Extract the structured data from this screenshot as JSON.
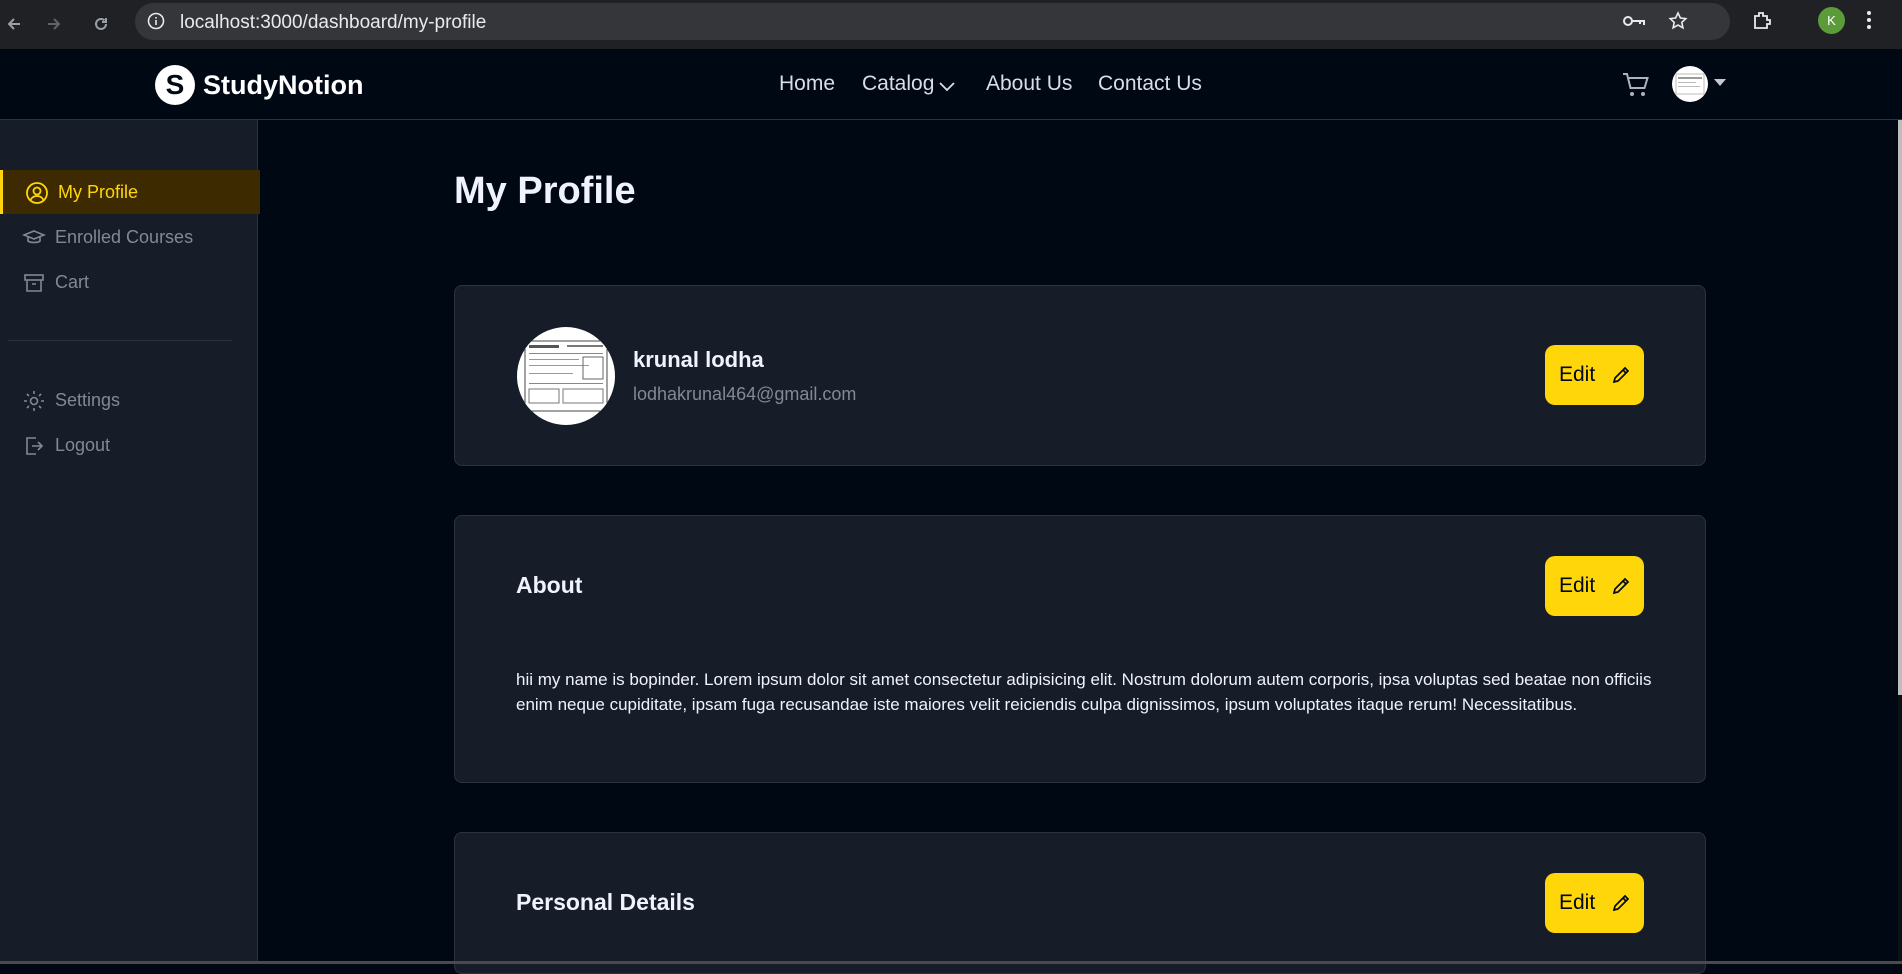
{
  "browser": {
    "url": "localhost:3000/dashboard/my-profile",
    "profile_initial": "K"
  },
  "navbar": {
    "brand": "StudyNotion",
    "brand_mark": "S",
    "links": [
      "Home",
      "Catalog",
      "About Us",
      "Contact Us"
    ]
  },
  "sidebar": {
    "items": [
      {
        "label": "My Profile",
        "icon": "user-circle-icon",
        "active": true
      },
      {
        "label": "Enrolled Courses",
        "icon": "graduation-cap-icon",
        "active": false
      },
      {
        "label": "Cart",
        "icon": "archive-icon",
        "active": false
      }
    ],
    "settings_label": "Settings",
    "logout_label": "Logout"
  },
  "main": {
    "title": "My Profile",
    "profile": {
      "name": "krunal lodha",
      "email": "lodhakrunal464@gmail.com",
      "edit_label": "Edit"
    },
    "about": {
      "title": "About",
      "text": "hii my name is bopinder. Lorem ipsum dolor sit amet consectetur adipisicing elit. Nostrum dolorum autem corporis, ipsa voluptas sed beatae non officiis enim neque cupiditate, ipsam fuga recusandae iste maiores velit reiciendis culpa dignissimos, ipsum voluptates itaque rerum! Necessitatibus.",
      "edit_label": "Edit"
    },
    "personal": {
      "title": "Personal Details",
      "edit_label": "Edit"
    }
  },
  "colors": {
    "accent": "#FFD60A",
    "background": "#000814",
    "card": "#161D29"
  }
}
